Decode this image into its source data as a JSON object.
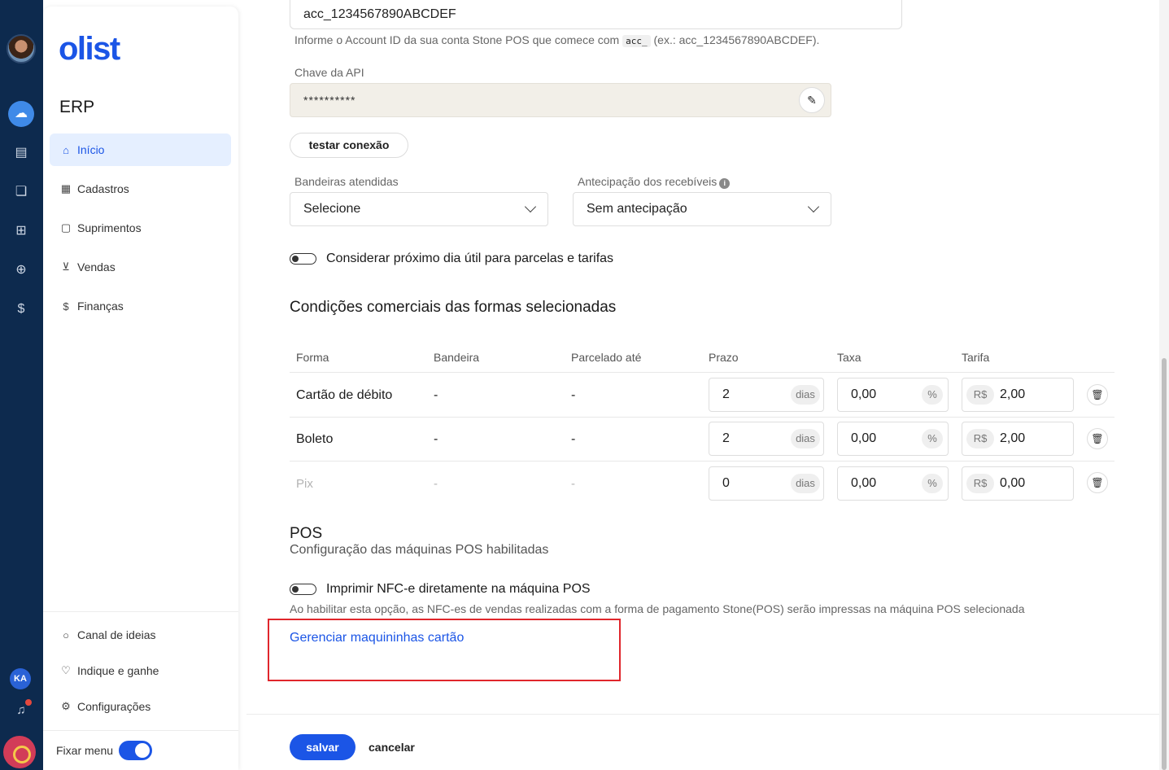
{
  "rail": {
    "user_initials": "KA",
    "icons": [
      "cloud-icon",
      "store-icon",
      "box-dollar-icon",
      "cart-icon",
      "chat-add-icon",
      "money-bag-icon"
    ]
  },
  "sidebar": {
    "logo": "olist",
    "section": "ERP",
    "items": [
      {
        "label": "Início",
        "icon": "home-icon"
      },
      {
        "label": "Cadastros",
        "icon": "document-icon"
      },
      {
        "label": "Suprimentos",
        "icon": "box-icon"
      },
      {
        "label": "Vendas",
        "icon": "cart-icon"
      },
      {
        "label": "Finanças",
        "icon": "money-icon"
      }
    ],
    "bottom_items": [
      {
        "label": "Canal de ideias",
        "icon": "lightbulb-icon"
      },
      {
        "label": "Indique e ganhe",
        "icon": "trophy-icon"
      },
      {
        "label": "Configurações",
        "icon": "gear-icon"
      }
    ],
    "fix_menu_label": "Fixar menu"
  },
  "form": {
    "account_id_value": "acc_1234567890ABCDEF",
    "account_help_pre": "Informe o Account ID da sua conta Stone POS que comece com",
    "account_help_code": "acc_",
    "account_help_post": "(ex.: acc_1234567890ABCDEF).",
    "api_key_label": "Chave da API",
    "api_key_value": "**********",
    "test_button": "testar conexão",
    "flags_label": "Bandeiras atendidas",
    "flags_value": "Selecione",
    "anticipation_label": "Antecipação dos recebíveis",
    "anticipation_value": "Sem antecipação",
    "next_business_day_label": "Considerar próximo dia útil para parcelas e tarifas"
  },
  "conditions": {
    "title": "Condições comerciais das formas selecionadas",
    "headers": [
      "Forma",
      "Bandeira",
      "Parcelado até",
      "Prazo",
      "Taxa",
      "Tarifa"
    ],
    "days_suffix": "dias",
    "percent_suffix": "%",
    "currency_prefix": "R$",
    "rows": [
      {
        "forma": "Cartão de débito",
        "bandeira": "-",
        "parcelado": "-",
        "prazo": "2",
        "taxa": "0,00",
        "tarifa": "2,00"
      },
      {
        "forma": "Boleto",
        "bandeira": "-",
        "parcelado": "-",
        "prazo": "2",
        "taxa": "0,00",
        "tarifa": "2,00"
      },
      {
        "forma": "Pix",
        "bandeira": "-",
        "parcelado": "-",
        "prazo": "0",
        "taxa": "0,00",
        "tarifa": "0,00"
      }
    ]
  },
  "pos": {
    "title": "POS",
    "subtitle": "Configuração das máquinas POS habilitadas",
    "print_toggle_label": "Imprimir NFC-e diretamente na máquina POS",
    "print_help": "Ao habilitar esta opção, as NFC-es de vendas realizadas com a forma de pagamento Stone(POS) serão impressas na máquina POS selecionada",
    "manage_link": "Gerenciar maquininhas cartão"
  },
  "footer": {
    "save": "salvar",
    "cancel": "cancelar"
  }
}
